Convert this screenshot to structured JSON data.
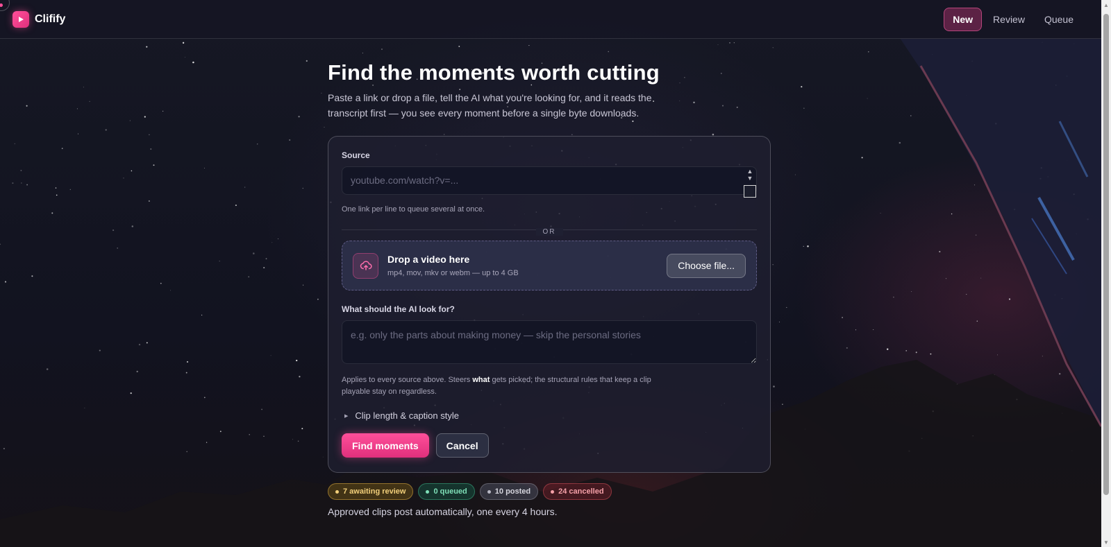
{
  "app": {
    "name": "Clifify",
    "logo_icon": "play-icon",
    "accent": "#ff4f9a"
  },
  "nav": {
    "items": [
      {
        "label": "New",
        "active": true
      },
      {
        "label": "Review",
        "active": false
      },
      {
        "label": "Queue",
        "active": false
      }
    ]
  },
  "hero": {
    "title": "Find the moments worth cutting",
    "subtitle": "Paste a link or drop a file, tell the AI what you're looking for, and it reads the transcript first — you see every moment before a single byte downloads."
  },
  "form": {
    "source_label": "Source",
    "source_placeholder": "youtube.com/watch?v=...",
    "source_value": "",
    "source_hint": "One link per line to queue several at once.",
    "or_text": "OR",
    "drop": {
      "icon": "cloud-upload-icon",
      "title": "Drop a video here",
      "subtitle": "mp4, mov, mkv or webm — up to 4 GB",
      "button": "Choose file..."
    },
    "ai_label": "What should the AI look for?",
    "ai_placeholder": "e.g. only the parts about making money — skip the personal stories",
    "ai_value": "",
    "ai_hint_before": "Applies to every source above. Steers ",
    "ai_hint_bold": "what",
    "ai_hint_after": " gets picked; the structural rules that keep a clip playable stay on regardless.",
    "details_label": "Clip length & caption style",
    "primary_button": "Find moments",
    "cancel_button": "Cancel"
  },
  "status": {
    "badges": [
      {
        "label": "7 awaiting review",
        "color": "#f2cf7a"
      },
      {
        "label": "0 queued",
        "color": "#7fe0b8"
      },
      {
        "label": "10 posted",
        "color": "#b8b8c4"
      },
      {
        "label": "24 cancelled",
        "color": "#f5a0a8"
      }
    ],
    "footnote": "Approved clips post automatically, one every 4 hours."
  }
}
